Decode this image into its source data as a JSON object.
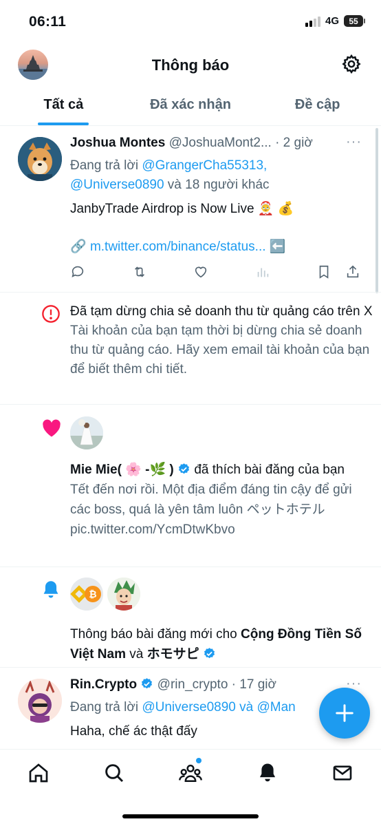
{
  "status_bar": {
    "time": "06:11",
    "network": "4G",
    "battery": "55"
  },
  "header": {
    "title": "Thông báo"
  },
  "tabs": [
    {
      "label": "Tất cả",
      "active": true
    },
    {
      "label": "Đã xác nhận",
      "active": false
    },
    {
      "label": "Đề cập",
      "active": false
    }
  ],
  "tweet1": {
    "name": "Joshua Montes",
    "handle": "@JoshuaMont2...",
    "time": "· 2 giờ",
    "reply_prefix": "Đang trả lời ",
    "reply_user1": "@GrangerCha55313,",
    "reply_user2": "@Universe0890",
    "reply_suffix": " và 18 người khác",
    "text": "JanbyTrade Airdrop is Now Live 🤶 💰",
    "link_emoji": "🔗",
    "link": "m.twitter.com/binance/status...",
    "link_after": "⬅️"
  },
  "alert": {
    "title": "Đã tạm dừng chia sẻ doanh thu từ quảng cáo trên X",
    "body": "Tài khoản của bạn tạm thời bị dừng chia sẻ doanh thu từ quảng cáo. Hãy xem email tài khoản của bạn để biết thêm chi tiết."
  },
  "like": {
    "name": "Mie Mie( 🌸 -🌿 )",
    "action": " đã thích bài đăng của bạn",
    "body": "Tết đến nơi rồi. Một địa điểm đáng tin cậy để gửi các boss, quá là yên tâm luôn ペットホテル pic.twitter.com/YcmDtwKbvo"
  },
  "bell": {
    "prefix": "Thông báo bài đăng mới cho ",
    "name1": "Cộng Đồng Tiền Số Việt Nam",
    "joiner": " và ",
    "name2": "ホモサピ"
  },
  "tweet2": {
    "name": "Rin.Crypto",
    "handle": "@rin_crypto",
    "time": "· 17 giờ",
    "reply_prefix": "Đang trả lời ",
    "reply_users": "@Universe0890 và @Man",
    "text": "Haha, chế ác thật đấy"
  },
  "more_label": "···",
  "colors": {
    "accent": "#1d9bf0",
    "like": "#f91880",
    "alert": "#f4212e"
  }
}
